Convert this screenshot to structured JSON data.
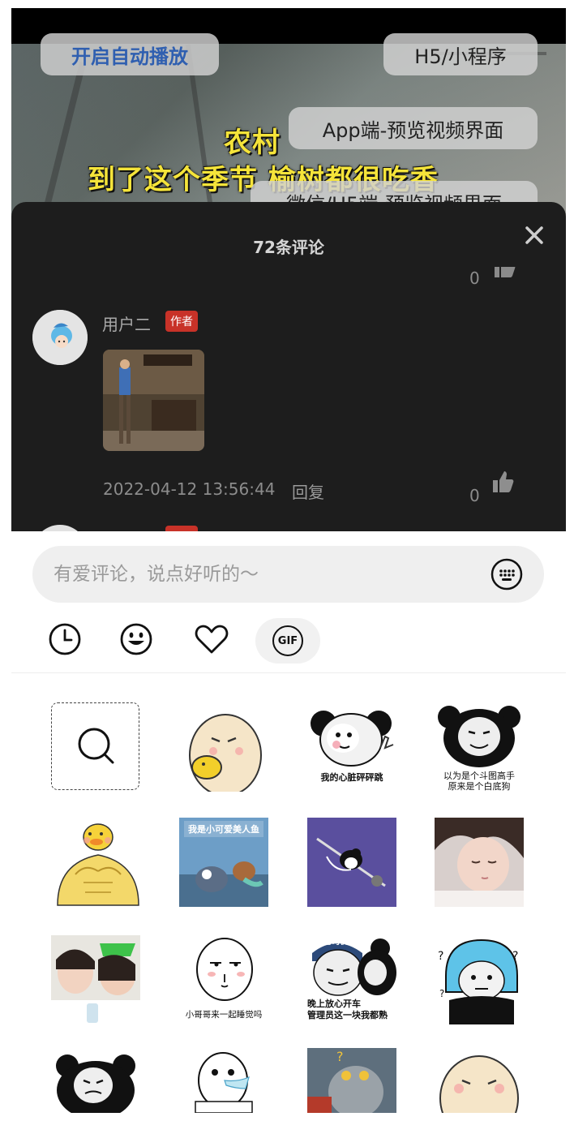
{
  "video": {
    "caption_line1": "农村",
    "caption_line2": "到了这个季节 榆树都很吃香",
    "buttons": {
      "autoplay": "开启自动播放",
      "h5_miniprogram": "H5/小程序",
      "app_preview": "App端-预览视频界面",
      "wechat_preview": "微信/H5端-预览视频界面"
    }
  },
  "comments": {
    "title": "72条评论",
    "peek_top_likes": "0",
    "items": [
      {
        "user": "用户二",
        "badge": "作者",
        "time": "2022-04-12 13:56:44",
        "reply": "回复",
        "likes": "0"
      }
    ],
    "next_badge": "作者"
  },
  "input": {
    "placeholder": "有爱评论，说点好听的～"
  },
  "tabs": [
    "recent-icon",
    "emoji-icon",
    "heart-icon",
    "gif-icon"
  ],
  "tab_gif_label": "GIF",
  "stickers": {
    "captions": {
      "heartbeat": "我的心脏砰砰跳",
      "dougu_1": "以为是个斗图高手",
      "dougu_2": "原来是个白底狗",
      "cute_fish": "我是小可爱美人鱼",
      "sleep": "小哥哥来一起睡觉吗",
      "driver_badge": "老司机",
      "driver_1": "晚上放心开车",
      "driver_2": "管理员这一块我都熟"
    }
  },
  "colors": {
    "sheet_bg": "#1d1d1d",
    "badge_red": "#c83228",
    "autoplay_blue": "#2f5fb0"
  }
}
